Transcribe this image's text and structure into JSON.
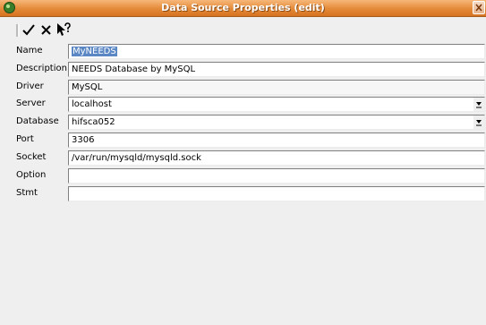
{
  "window": {
    "title": "Data Source Properties (edit)"
  },
  "toolbar": {
    "ok_icon": "checkmark-icon",
    "cancel_icon": "x-icon",
    "help_icon": "help-cursor-icon"
  },
  "fields": [
    {
      "label": "Name",
      "value": "MyNEEDS",
      "type": "text",
      "selected": true
    },
    {
      "label": "Description",
      "value": "NEEDS Database by MySQL",
      "type": "text"
    },
    {
      "label": "Driver",
      "value": "MySQL",
      "type": "readonly"
    },
    {
      "label": "Server",
      "value": "localhost",
      "type": "combo"
    },
    {
      "label": "Database",
      "value": "hifsca052",
      "type": "combo"
    },
    {
      "label": "Port",
      "value": "3306",
      "type": "text"
    },
    {
      "label": "Socket",
      "value": "/var/run/mysqld/mysqld.sock",
      "type": "text"
    },
    {
      "label": "Option",
      "value": "",
      "type": "text"
    },
    {
      "label": "Stmt",
      "value": "",
      "type": "text"
    }
  ]
}
